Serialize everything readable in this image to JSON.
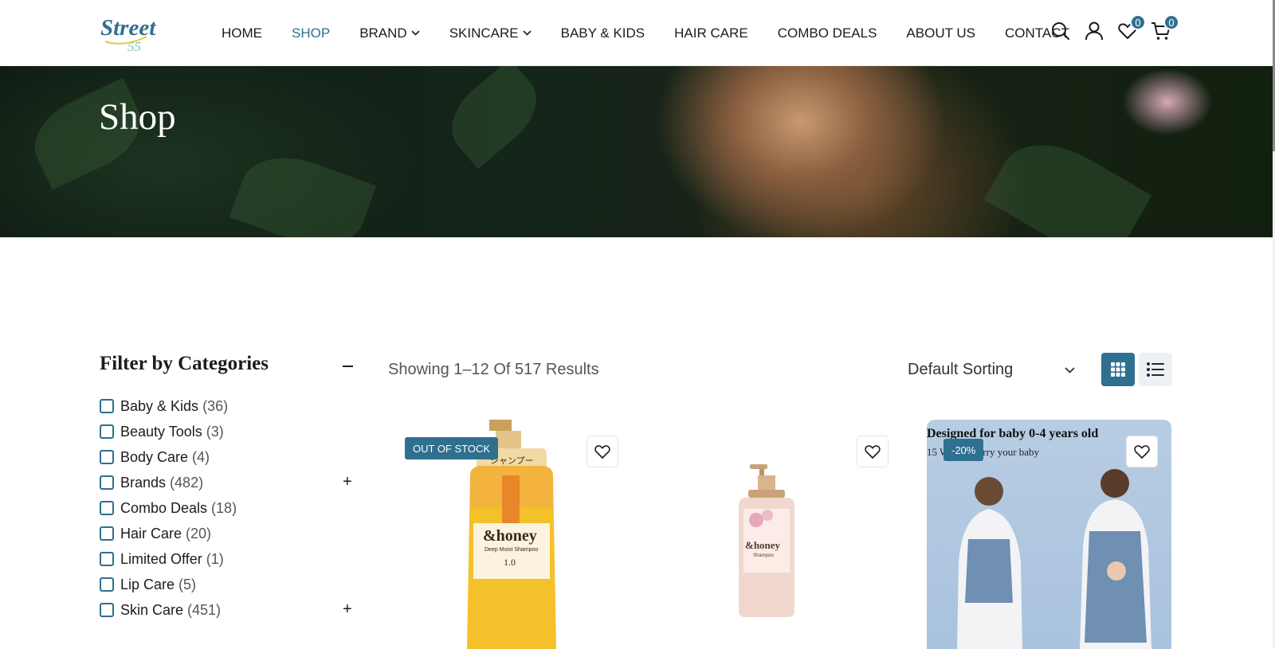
{
  "brand": {
    "logo_text": "Street",
    "logo_number": "55"
  },
  "nav": {
    "items": [
      {
        "label": "HOME"
      },
      {
        "label": "SHOP",
        "active": true
      },
      {
        "label": "BRAND",
        "dropdown": true
      },
      {
        "label": "SKINCARE",
        "dropdown": true
      },
      {
        "label": "BABY & KIDS"
      },
      {
        "label": "HAIR CARE"
      },
      {
        "label": "COMBO DEALS"
      },
      {
        "label": "ABOUT US"
      },
      {
        "label": "CONTACT"
      }
    ]
  },
  "header_icons": {
    "search": "search-icon",
    "account": "user-icon",
    "wishlist": {
      "icon": "heart-icon",
      "count": "0"
    },
    "cart": {
      "icon": "cart-icon",
      "count": "0"
    }
  },
  "hero": {
    "title": "Shop"
  },
  "filter": {
    "title": "Filter by Categories",
    "categories": [
      {
        "name": "Baby & Kids",
        "count": "(36)"
      },
      {
        "name": "Beauty Tools",
        "count": "(3)"
      },
      {
        "name": "Body Care",
        "count": "(4)"
      },
      {
        "name": "Brands",
        "count": "(482)",
        "expandable": true
      },
      {
        "name": "Combo Deals",
        "count": "(18)"
      },
      {
        "name": "Hair Care",
        "count": "(20)"
      },
      {
        "name": "Limited Offer",
        "count": "(1)"
      },
      {
        "name": "Lip Care",
        "count": "(5)"
      },
      {
        "name": "Skin Care",
        "count": "(451)",
        "expandable": true
      }
    ]
  },
  "toolbar": {
    "results_text": "Showing 1–12 Of 517 Results",
    "sort_selected": "Default Sorting",
    "view_mode": "grid"
  },
  "products": [
    {
      "badge": "OUT OF STOCK",
      "label_jp": "シャンプー",
      "brand_text": "&honey",
      "sub_text": "Deep Moist Shampoo",
      "version": "1.0"
    },
    {
      "brand_text": "&honey",
      "sub_text": "Shampoo"
    },
    {
      "badge": "-20%",
      "promo_line1": "Designed for baby 0-4 years old",
      "promo_line2": "15 W",
      "promo_line2b": "rry your baby"
    }
  ],
  "colors": {
    "accent": "#2f6f8f",
    "text": "#1c1c1c"
  }
}
